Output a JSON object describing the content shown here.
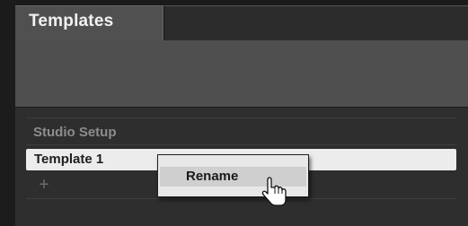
{
  "tabs": {
    "active_label": "Templates"
  },
  "templates": {
    "section_title": "Studio Setup",
    "items": [
      {
        "label": "Template 1",
        "selected": true
      }
    ],
    "add_symbol": "+"
  },
  "context_menu": {
    "items": [
      {
        "label": "Rename"
      }
    ]
  },
  "icons": {
    "cursor": "hand-pointer-icon",
    "add": "plus-icon"
  }
}
